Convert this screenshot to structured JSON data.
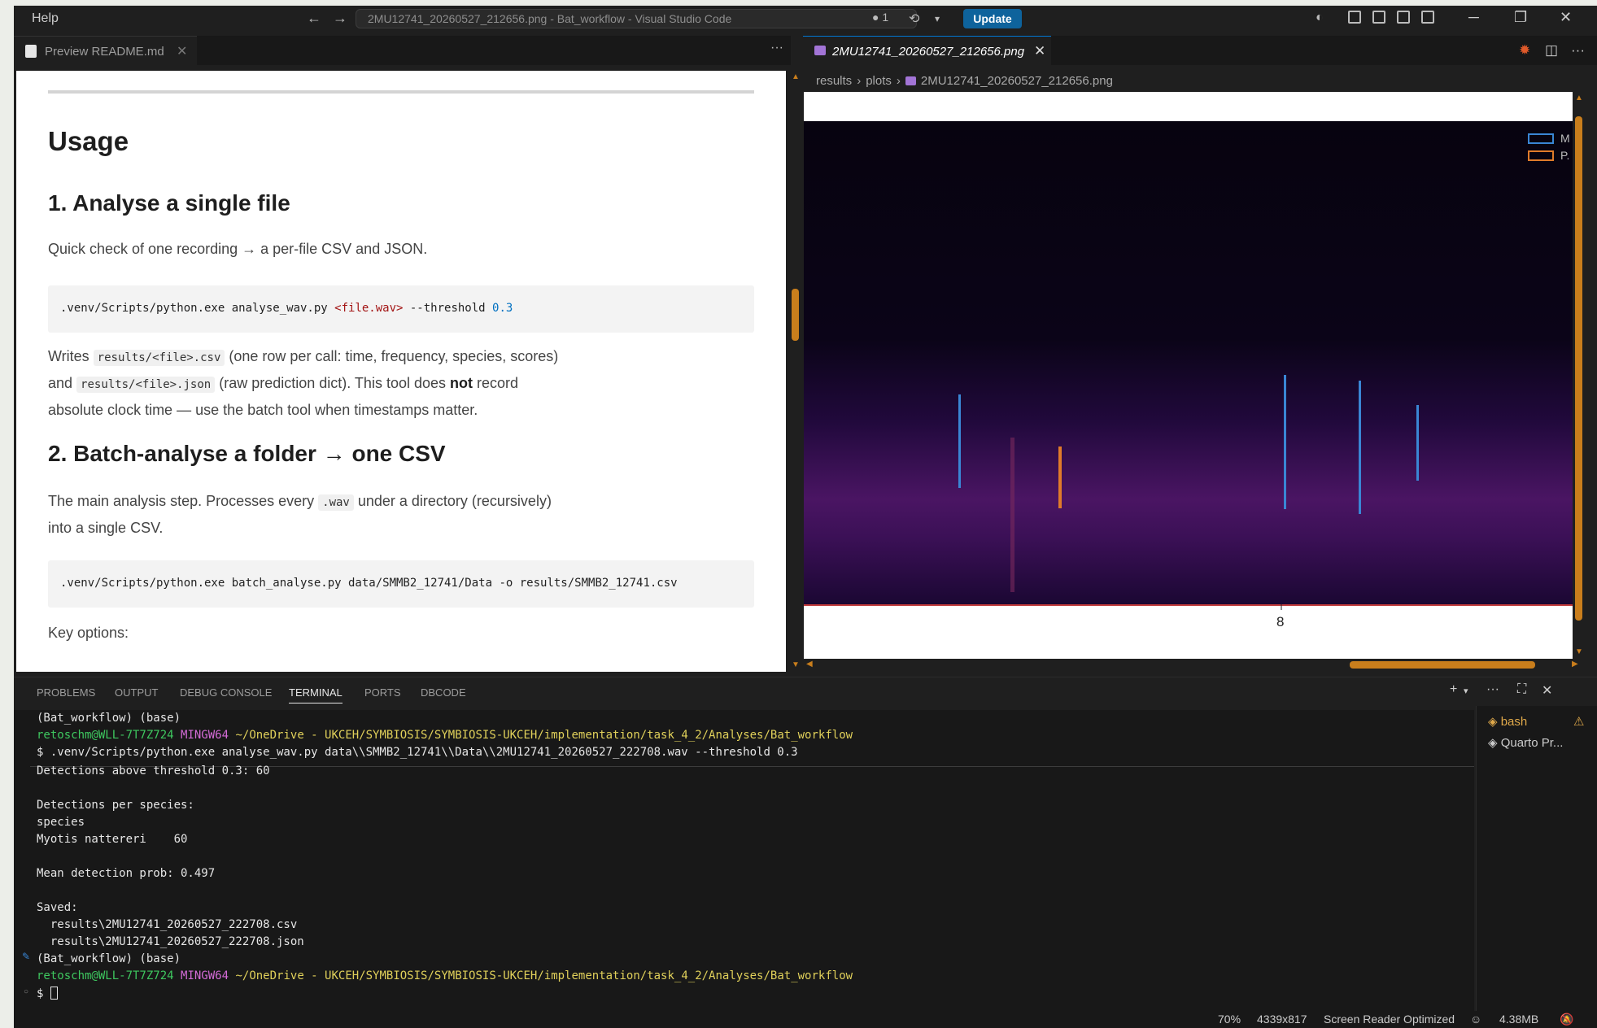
{
  "titlebar": {
    "menu_help": "Help",
    "window_title": "2MU12741_20260527_212656.png - Bat_workflow - Visual Studio Code",
    "dirty_count": "● 1",
    "update_label": "Update"
  },
  "left_editor": {
    "tab_label": "Preview README.md",
    "heading_usage": "Usage",
    "h2_single": "1. Analyse a single file",
    "p_single": "Quick check of one recording → a per-file CSV and JSON.",
    "code_single_1": ".venv/Scripts/python.exe analyse_wav.py ",
    "code_single_2": "<file.wav>",
    "code_single_3": " --threshold ",
    "code_single_4": "0.3",
    "p_writes_1": "Writes ",
    "p_writes_code1": "results/<file>.csv",
    "p_writes_2": " (one row per call: time, frequency, species, scores)",
    "p_writes_3": "and ",
    "p_writes_code2": "results/<file>.json",
    "p_writes_4": " (raw prediction dict). This tool does ",
    "p_writes_bold": "not",
    "p_writes_5": " record",
    "p_writes_6": "absolute clock time — use the batch tool when timestamps matter.",
    "h2_batch": "2. Batch-analyse a folder → one CSV",
    "p_batch_1": "The main analysis step. Processes every ",
    "p_batch_code": ".wav",
    "p_batch_2": " under a directory (recursively)",
    "p_batch_3": "into a single CSV.",
    "code_batch": ".venv/Scripts/python.exe batch_analyse.py data/SMMB2_12741/Data -o results/SMMB2_12741.csv",
    "p_key_options": "Key options:"
  },
  "right_editor": {
    "tab_label": "2MU12741_20260527_212656.png",
    "breadcrumb": [
      "results",
      "plots",
      "2MU12741_20260527_212656.png"
    ],
    "legend": [
      {
        "label": "M",
        "color": "#3a86d4"
      },
      {
        "label": "P.",
        "color": "#e07b2a"
      }
    ],
    "x_tick": "8"
  },
  "panel": {
    "tabs": [
      "PROBLEMS",
      "OUTPUT",
      "DEBUG CONSOLE",
      "TERMINAL",
      "PORTS",
      "DBCODE"
    ],
    "active_tab": "TERMINAL",
    "terminal": {
      "env_1": "(Bat_workflow) (base)",
      "user": "retoschm@WLL-7T7Z724",
      "shell": "MINGW64",
      "path": "~/OneDrive - UKCEH/SYMBIOSIS/SYMBIOSIS-UKCEH/implementation/task_4_2/Analyses/Bat_workflow",
      "command": "$ .venv/Scripts/python.exe analyse_wav.py data\\\\SMMB2_12741\\\\Data\\\\2MU12741_20260527_222708.wav --threshold 0.3",
      "out_detections": "Detections above threshold 0.3: 60",
      "out_per_species": "Detections per species:",
      "out_species": "species",
      "out_myotis": "Myotis nattereri    60",
      "out_mean": "Mean detection prob: 0.497",
      "out_saved": "Saved:",
      "out_csv": "  results\\2MU12741_20260527_222708.csv",
      "out_json": "  results\\2MU12741_20260527_222708.json",
      "env_2": "(Bat_workflow) (base)",
      "prompt": "$ "
    },
    "sessions": [
      "bash",
      "Quarto Pr..."
    ]
  },
  "statusbar": {
    "zoom": "70%",
    "dimensions": "4339x817",
    "screen_reader": "Screen Reader Optimized",
    "memory": "4.38MB"
  },
  "colors": {
    "accent": "#0e639c",
    "scroll_thumb": "#c97e1c",
    "prompt_green": "#3ec75f",
    "prompt_magenta": "#d36bd6",
    "prompt_yellow": "#e0d05a"
  }
}
